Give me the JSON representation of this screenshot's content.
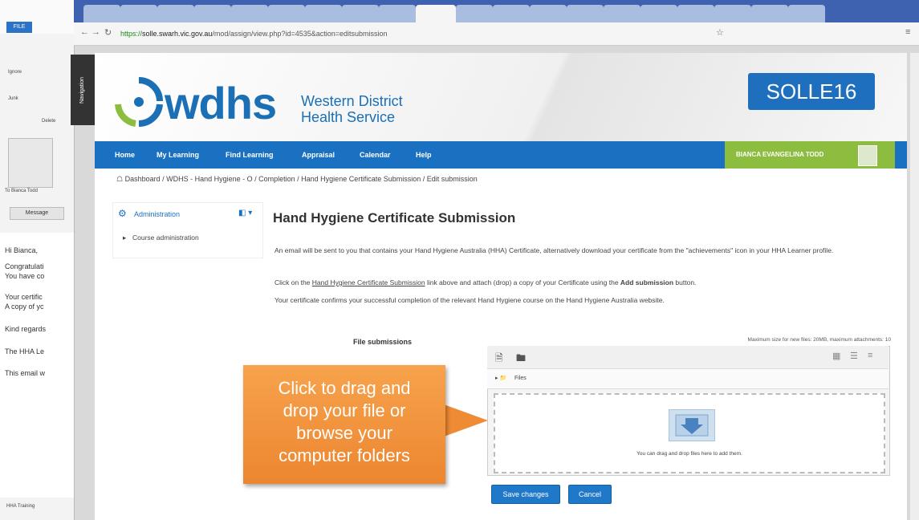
{
  "outlook": {
    "file_label": "FILE",
    "ignore": "Ignore",
    "junk": "Junk",
    "delete": "Delete",
    "to": "To Bianca Todd",
    "message_btn": "Message",
    "body_lines": [
      "Hi Bianca,",
      "Congratulati",
      "You have co",
      "Your certific",
      "A copy of yc",
      "Kind regards",
      "The HHA Le",
      "This email w"
    ],
    "footer": "HHA Training"
  },
  "browser": {
    "url_secure": "https://",
    "url_host": "solle.swarh.vic.gov.au",
    "url_path": "/mod/assign/view.php?id=4535&action=editsubmission"
  },
  "site": {
    "logo_word": "wdhs",
    "logo_sub1": "Western District",
    "logo_sub2": "Health Service",
    "badge": "SOLLE16",
    "nav_flag": "Navigation",
    "menu": [
      "Home",
      "My Learning",
      "Find Learning",
      "Appraisal",
      "Calendar",
      "Help"
    ],
    "user": "BIANCA EVANGELINA TODD"
  },
  "breadcrumb": "Dashboard / WDHS - Hand Hygiene - O / Completion / Hand Hygiene Certificate Submission / Edit submission",
  "admin": {
    "title": "Administration",
    "item": "Course administration"
  },
  "main": {
    "title": "Hand Hygiene Certificate Submission",
    "para1": "An email will be sent to you that contains your Hand Hygiene Australia (HHA) Certificate, alternatively download your certificate from the \"achievements\" icon in your HHA Learner profile.",
    "para2a": "Click on the ",
    "para2link": "Hand Hygiene Certificate Submission",
    "para2b": " link above and attach (drop) a copy of your Certificate using the ",
    "para2bold": "Add submission",
    "para2c": " button.",
    "para3": "Your certificate confirms your successful completion of the relevant Hand Hygiene course on the Hand Hygiene Australia website.",
    "fs_label": "File submissions",
    "fs_max": "Maximum size for new files: 20MB, maximum attachments: 10",
    "files_path": "Files",
    "drop_text": "You can drag and drop files here to add them.",
    "save": "Save changes",
    "cancel": "Cancel"
  },
  "callout": {
    "line1": "Click to drag and",
    "line2": "drop your file or",
    "line3": "browse your",
    "line4": "computer folders"
  }
}
